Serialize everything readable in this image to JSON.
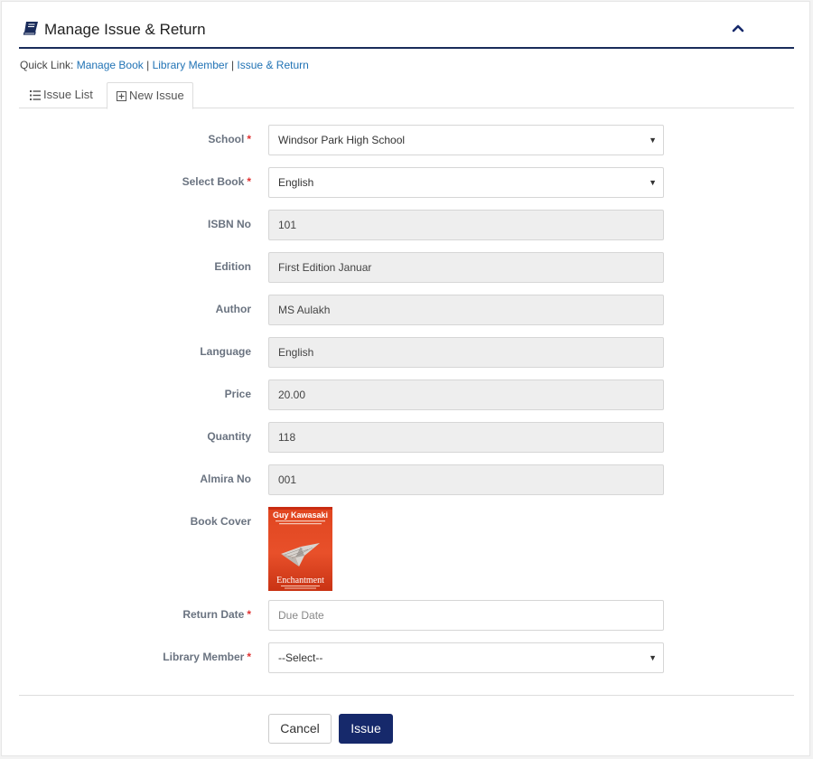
{
  "header": {
    "title": "Manage Issue & Return"
  },
  "quick_links": {
    "prefix": "Quick Link:",
    "links": [
      "Manage Book",
      "Library Member",
      "Issue & Return"
    ],
    "separator": "|"
  },
  "tabs": [
    {
      "label": "Issue List",
      "active": false
    },
    {
      "label": "New Issue",
      "active": true
    }
  ],
  "form": {
    "school": {
      "label": "School",
      "value": "Windsor Park High School",
      "required": true
    },
    "book": {
      "label": "Select Book",
      "value": "English",
      "required": true
    },
    "isbn": {
      "label": "ISBN No",
      "value": "101"
    },
    "edition": {
      "label": "Edition",
      "value": "First Edition Januar"
    },
    "author": {
      "label": "Author",
      "value": "MS Aulakh"
    },
    "language": {
      "label": "Language",
      "value": "English"
    },
    "price": {
      "label": "Price",
      "value": "20.00"
    },
    "quantity": {
      "label": "Quantity",
      "value": "118"
    },
    "almira": {
      "label": "Almira No",
      "value": "001"
    },
    "cover": {
      "label": "Book Cover",
      "author": "Guy Kawasaki",
      "title": "Enchantment"
    },
    "return_date": {
      "label": "Return Date",
      "placeholder": "Due Date",
      "required": true
    },
    "member": {
      "label": "Library Member",
      "value": "--Select--",
      "required": true
    },
    "required_mark": "*"
  },
  "actions": {
    "cancel": "Cancel",
    "issue": "Issue"
  },
  "colors": {
    "accent": "#1a2c5b",
    "link": "#2173b5",
    "primary_button": "#16296b",
    "required": "#e03232"
  },
  "icons": {
    "title": "book-icon",
    "collapse": "chevron-up-icon",
    "tab_list": "list-icon",
    "tab_new": "plus-square-icon",
    "select": "caret-down-icon"
  }
}
